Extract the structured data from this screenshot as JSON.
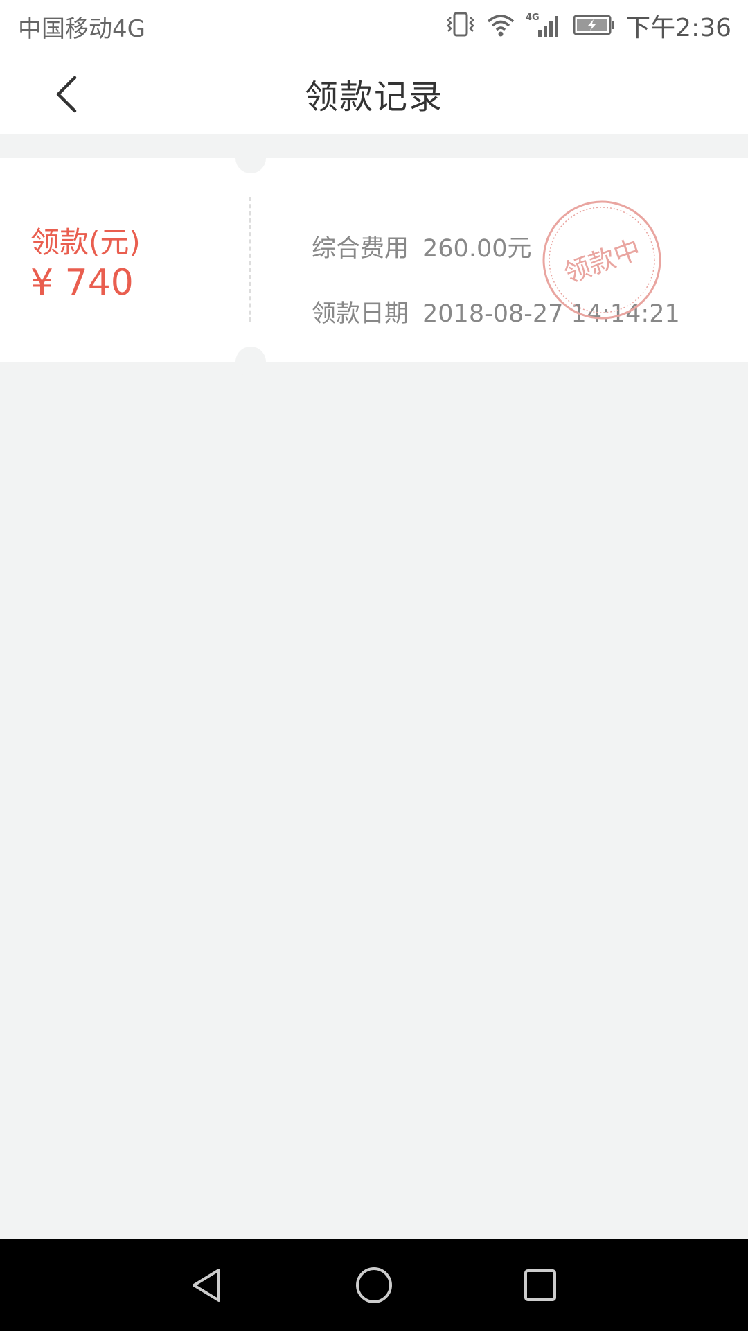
{
  "status_bar": {
    "carrier": "中国移动4G",
    "network_badge": "4G",
    "time": "下午2:36",
    "icons": [
      "vibrate-icon",
      "wifi-icon",
      "cellular-signal-icon",
      "battery-charging-icon"
    ]
  },
  "nav": {
    "title": "领款记录",
    "back_icon": "chevron-left-icon"
  },
  "record": {
    "amount_label": "领款(元)",
    "amount_value": "¥ 740",
    "fee_label": "综合费用",
    "fee_value": "260.00元",
    "date_label": "领款日期",
    "date_value": "2018-08-27 14:14:21",
    "stamp_text": "领款中"
  },
  "colors": {
    "accent": "#e95e4f",
    "stamp": "#e9a5a0",
    "background": "#f2f3f3",
    "title": "#333333",
    "muted": "#888888"
  },
  "system_nav": {
    "icons": [
      "back-triangle-icon",
      "home-circle-icon",
      "recents-square-icon"
    ]
  }
}
